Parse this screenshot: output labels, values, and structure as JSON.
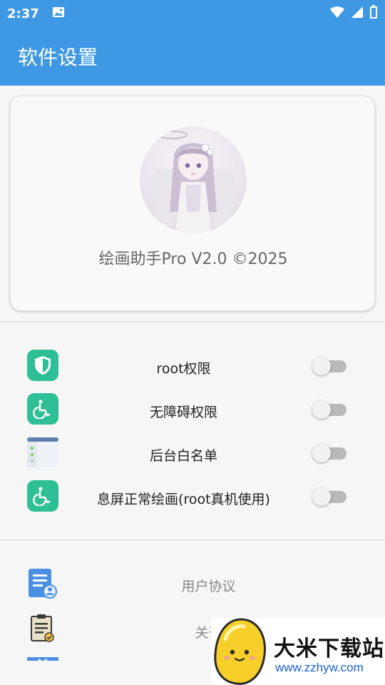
{
  "status_bar": {
    "time": "2:37"
  },
  "app_bar": {
    "title": "软件设置"
  },
  "card": {
    "version_text": "绘画助手Pro V2.0 ©2025"
  },
  "settings": [
    {
      "label": "root权限",
      "icon": "shield-icon",
      "enabled": false
    },
    {
      "label": "无障碍权限",
      "icon": "accessibility-icon",
      "enabled": false
    },
    {
      "label": "后台白名单",
      "icon": "app-window-icon",
      "enabled": false
    },
    {
      "label": "息屏正常绘画(root真机使用)",
      "icon": "accessibility-icon",
      "enabled": false
    }
  ],
  "links": [
    {
      "label": "用户协议",
      "icon": "user-agreement-icon"
    },
    {
      "label": "关于",
      "icon": "clipboard-check-icon"
    }
  ],
  "watermark": {
    "title": "大米下载站",
    "url": "www.zzhyw.com"
  },
  "colors": {
    "primary": "#3f98e3",
    "icon_green": "#2fbf95"
  }
}
